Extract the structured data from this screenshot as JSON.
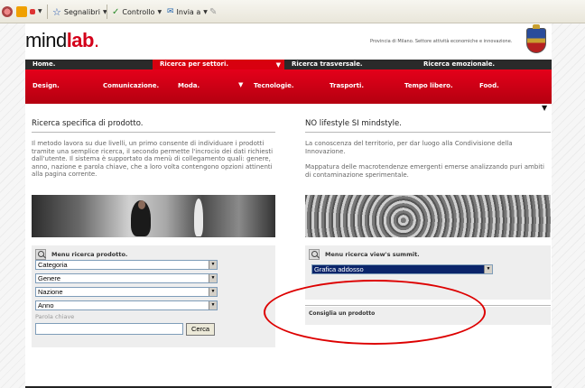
{
  "browser_toolbar": {
    "bookmarks_label": "Segnalibri",
    "check_label": "Controllo",
    "send_label": "Invia a"
  },
  "header": {
    "logo_mind": "mind",
    "logo_lab": "lab",
    "logo_dot": ".",
    "province": "Provincia di Milano. Settore attività economiche e innovazione."
  },
  "nav_top": {
    "items": [
      {
        "label": "Home."
      },
      {
        "label": "Ricerca per settori."
      },
      {
        "label": "Ricerca trasversale."
      },
      {
        "label": "Ricerca emozionale."
      }
    ]
  },
  "nav_sub": {
    "items": [
      {
        "label": "Design."
      },
      {
        "label": "Comunicazione."
      },
      {
        "label": "Moda."
      },
      {
        "label": "Tecnologie."
      },
      {
        "label": "Trasporti."
      },
      {
        "label": "Tempo libero."
      },
      {
        "label": "Food."
      }
    ]
  },
  "left": {
    "title": "Ricerca specifica di prodotto.",
    "text": "Il metodo lavora su due livelli, un primo consente di individuare i prodotti tramite una semplice ricerca, il secondo permette l'incrocio dei dati richiesti dall'utente. Il sistema è supportato da menù di collegamento quali: genere, anno, nazione e parola chiave, che a loro volta contengono opzioni attinenti alla pagina corrente.",
    "panel_title": "Menu ricerca prodotto.",
    "selects": [
      "Categoria",
      "Genere",
      "Nazione",
      "Anno"
    ],
    "keyword_label": "Parola chiave",
    "search_button": "Cerca"
  },
  "right": {
    "title": "NO lifestyle SI mindstyle.",
    "text1": "La conoscenza del territorio, per dar luogo alla Condivisione della Innovazione.",
    "text2": "Mappatura delle macrotendenze emergenti emerse analizzando puri ambiti di contaminazione sperimentale.",
    "panel_title": "Menu ricerca view's summit.",
    "select_value": "Grafica addosso",
    "suggest_title": "Consiglia un prodotto"
  },
  "colors": {
    "brand_red": "#d8000f",
    "annotation_red": "#dd0000"
  }
}
